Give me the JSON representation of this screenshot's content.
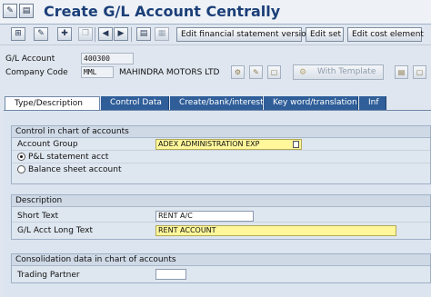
{
  "window": {
    "title": "Create G/L Account Centrally",
    "title_icons": [
      "display-change-icon",
      "document-icon"
    ]
  },
  "toolbar": {
    "buttons": [
      {
        "name": "display-icon",
        "glyph": "⊞"
      },
      {
        "name": "edit-icon",
        "glyph": "✎"
      },
      {
        "name": "create-icon",
        "glyph": "✚"
      },
      {
        "name": "copy-icon",
        "glyph": "❐"
      },
      {
        "name": "previous-icon",
        "glyph": "◀"
      },
      {
        "name": "next-icon",
        "glyph": "▶"
      },
      {
        "name": "notes-icon",
        "glyph": "▤"
      },
      {
        "name": "info-icon",
        "glyph": "▦"
      }
    ],
    "text_buttons": {
      "edit_fs_version": "Edit financial statement version",
      "edit_set": "Edit set",
      "edit_cost_element": "Edit cost element"
    }
  },
  "header": {
    "gl_account_label": "G/L Account",
    "gl_account_value": "400300",
    "company_code_label": "Company Code",
    "company_code_value": "MML",
    "company_name": "MAHINDRA MOTORS LTD",
    "with_template": "With Template"
  },
  "tabs": [
    {
      "label": "Type/Description",
      "active": true
    },
    {
      "label": "Control Data",
      "active": false
    },
    {
      "label": "Create/bank/interest",
      "active": false
    },
    {
      "label": "Key word/translation",
      "active": false
    },
    {
      "label": "Inf",
      "active": false
    }
  ],
  "control_group": {
    "title": "Control in chart of accounts",
    "account_group_label": "Account Group",
    "account_group_value": "ADEX ADMINISTRATION EXP",
    "radio_pl": "P&L statement acct",
    "radio_bs": "Balance sheet account",
    "selected": "P&L statement acct"
  },
  "description_group": {
    "title": "Description",
    "short_text_label": "Short Text",
    "short_text_value": "RENT A/C",
    "long_text_label": "G/L Acct Long Text",
    "long_text_value": "RENT ACCOUNT"
  },
  "consolidation_group": {
    "title": "Consolidation data in chart of accounts",
    "trading_partner_label": "Trading Partner",
    "trading_partner_value": ""
  },
  "colors": {
    "title_text": "#1b3f78",
    "tab_inactive": "#2f5e99",
    "required_field": "#fff79a"
  }
}
